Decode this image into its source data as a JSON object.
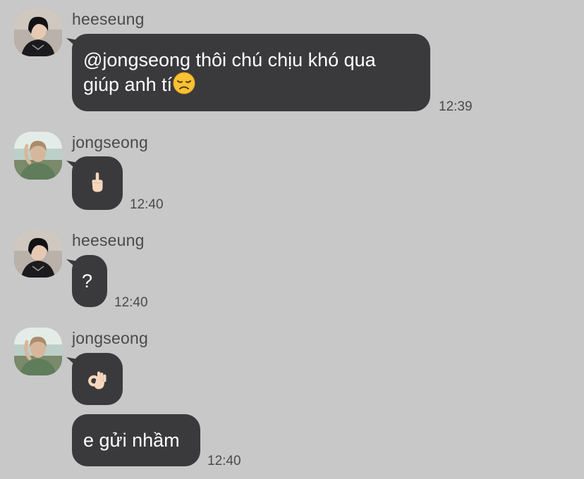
{
  "messages": [
    {
      "sender": "heeseung",
      "avatar_icon": "avatar-dark-hair-person",
      "text": "@jongseong thôi chú chịu khó qua\ngiúp anh tí",
      "emoji_icon": "disappointed-face-icon",
      "time": "12:39"
    },
    {
      "sender": "jongseong",
      "avatar_icon": "avatar-person-outdoors",
      "emoji_icon": "middle-finger-icon",
      "time": "12:40"
    },
    {
      "sender": "heeseung",
      "avatar_icon": "avatar-dark-hair-person",
      "text": "?",
      "time": "12:40"
    },
    {
      "sender": "jongseong",
      "avatar_icon": "avatar-person-outdoors",
      "emoji_icon": "ok-hand-icon",
      "followup_text": "e gửi nhầm",
      "time": "12:40"
    }
  ],
  "colors": {
    "background": "#c8c8c8",
    "bubble": "#3a3a3c",
    "bubble_text": "#ffffff",
    "meta_text": "#4a4a4a"
  }
}
